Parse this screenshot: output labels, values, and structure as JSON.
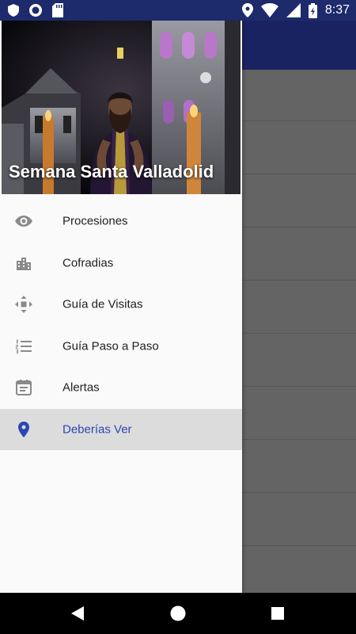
{
  "status_bar": {
    "time": "8:37",
    "left_icons": [
      "shield-icon",
      "sync-icon",
      "sd-card-icon"
    ],
    "right_icons": [
      "location-icon",
      "wifi-icon",
      "signal-icon",
      "battery-icon"
    ]
  },
  "drawer": {
    "header_title": "Semana Santa Valladolid",
    "items": [
      {
        "label": "Procesiones",
        "icon": "eye-icon",
        "active": false
      },
      {
        "label": "Cofradias",
        "icon": "buildings-icon",
        "active": false
      },
      {
        "label": "Guía de Visitas",
        "icon": "move-arrows-icon",
        "active": false
      },
      {
        "label": "Guía Paso a Paso",
        "icon": "numbered-list-icon",
        "active": false
      },
      {
        "label": "Alertas",
        "icon": "calendar-icon",
        "active": false
      },
      {
        "label": "Deberías Ver",
        "icon": "place-icon",
        "active": true
      }
    ]
  },
  "colors": {
    "status_bar": "#1d2a6b",
    "toolbar": "#1a2361",
    "active_accent": "#2b46b0",
    "active_bg": "#dcdcdc",
    "icon_gray": "#8a8a8a"
  },
  "nav_bar": {
    "buttons": [
      "back-icon",
      "home-icon",
      "recents-icon"
    ]
  }
}
